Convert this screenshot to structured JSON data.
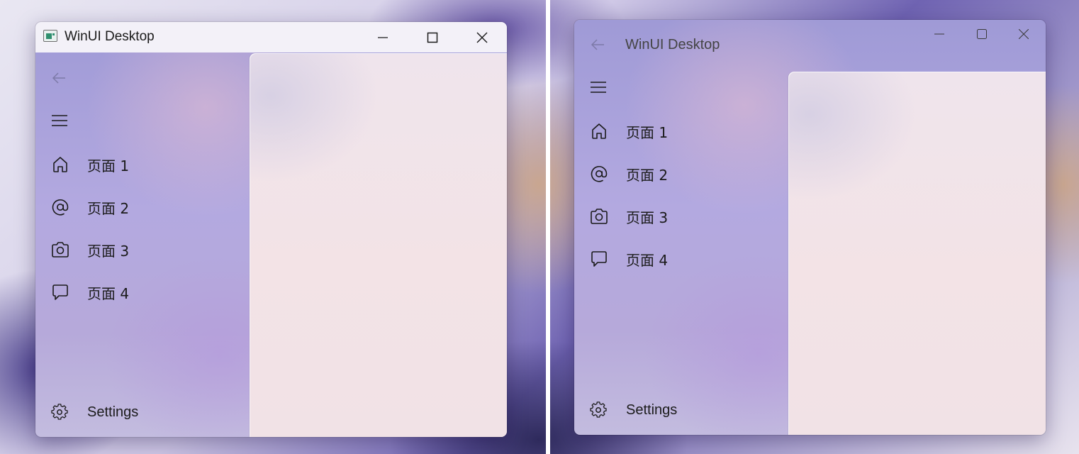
{
  "app_title": "WinUI Desktop",
  "left_window": {
    "title": "WinUI Desktop",
    "nav_items": [
      {
        "icon": "home-icon",
        "label": "页面 1"
      },
      {
        "icon": "at-sign-icon",
        "label": "页面 2"
      },
      {
        "icon": "camera-icon",
        "label": "页面 3"
      },
      {
        "icon": "chat-bubble-icon",
        "label": "页面 4"
      }
    ],
    "settings_label": "Settings"
  },
  "right_window": {
    "title": "WinUI Desktop",
    "nav_items": [
      {
        "icon": "home-icon",
        "label": "页面 1"
      },
      {
        "icon": "at-sign-icon",
        "label": "页面 2"
      },
      {
        "icon": "camera-icon",
        "label": "页面 3"
      },
      {
        "icon": "chat-bubble-icon",
        "label": "页面 4"
      }
    ],
    "settings_label": "Settings"
  },
  "colors": {
    "pane_tint": "#b3a9e0",
    "content_bg": "#f3e3e6",
    "titlebar_bg": "#f3f1f8"
  }
}
